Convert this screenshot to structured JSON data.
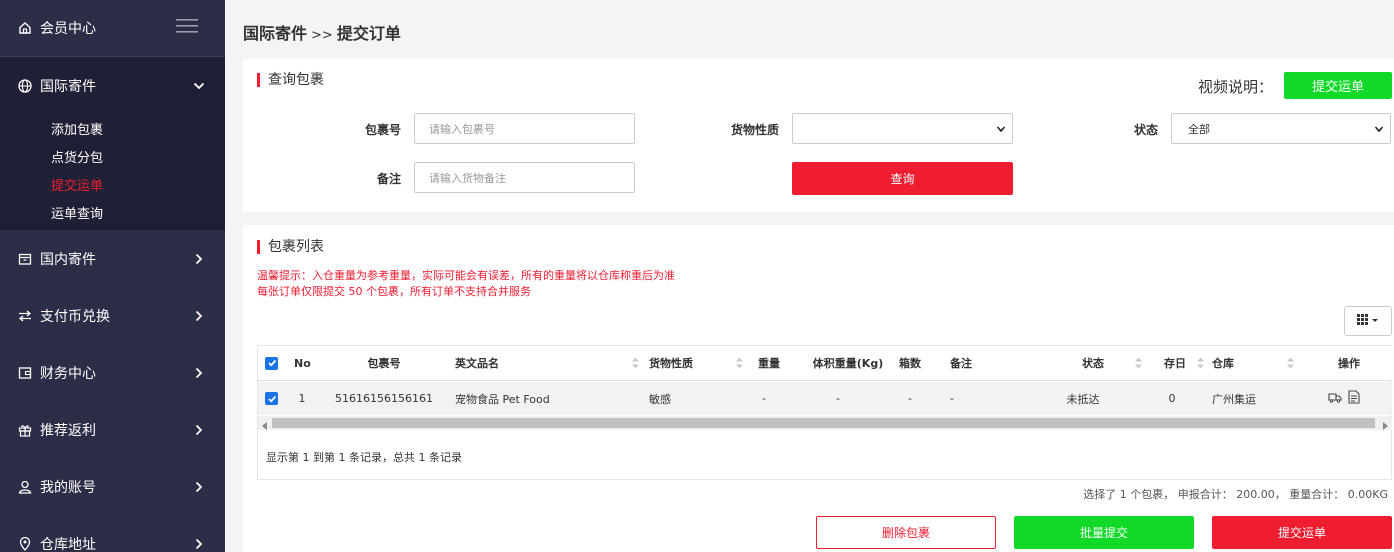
{
  "sidebar": {
    "top_label": "会员中心",
    "groups": [
      {
        "label": "国际寄件",
        "expanded": true,
        "items": [
          {
            "label": "添加包裹",
            "active": false
          },
          {
            "label": "点货分包",
            "active": false
          },
          {
            "label": "提交运单",
            "active": true
          },
          {
            "label": "运单查询",
            "active": false
          }
        ]
      },
      {
        "label": "国内寄件"
      },
      {
        "label": "支付币兑换"
      },
      {
        "label": "财务中心"
      },
      {
        "label": "推荐返利"
      },
      {
        "label": "我的账号"
      },
      {
        "label": "仓库地址"
      }
    ]
  },
  "breadcrumb": {
    "parent": "国际寄件",
    "sep": ">>",
    "current": "提交订单"
  },
  "query": {
    "title": "查询包裹",
    "video_label": "视频说明：",
    "video_button": "提交运单",
    "package_no_label": "包裹号",
    "package_no_placeholder": "请输入包裹号",
    "goods_type_label": "货物性质",
    "goods_type_value": "",
    "status_label": "状态",
    "status_value": "全部",
    "remark_label": "备注",
    "remark_placeholder": "请输入货物备注",
    "search_button": "查询"
  },
  "list": {
    "title": "包裹列表",
    "notice1": "温馨提示：入仓重量为参考重量，实际可能会有误差，所有的重量将以仓库称重后为准",
    "notice2": "每张订单仅限提交 50 个包裹，所有订单不支持合并服务",
    "columns": [
      "No",
      "包裹号",
      "英文品名",
      "货物性质",
      "重量",
      "体积重量(Kg)",
      "箱数",
      "备注",
      "状态",
      "存日",
      "仓库",
      "操作"
    ],
    "rows": [
      {
        "checked": true,
        "no": "1",
        "package_no": "51616156156161",
        "name_en": "宠物食品 Pet Food",
        "goods_type": "敏感",
        "weight": "-",
        "vol_weight": "-",
        "boxes": "-",
        "remark": "-",
        "status": "未抵达",
        "days": "0",
        "warehouse": "广州集运"
      }
    ],
    "pager": "显示第 1 到第 1 条记录，总共 1 条记录",
    "summary": "选择了 1 个包裹， 申报合计： 200.00， 重量合计： 0.00KG"
  },
  "actions": {
    "delete": "删除包裹",
    "batch": "批量提交",
    "submit": "提交运单"
  },
  "colors": {
    "accent_red": "#ee1d30",
    "accent_green": "#11d928",
    "sidebar_bg": "#2c2e47",
    "sidebar_active_bg": "#1f2036",
    "checkbox_blue": "#1b73e8"
  }
}
